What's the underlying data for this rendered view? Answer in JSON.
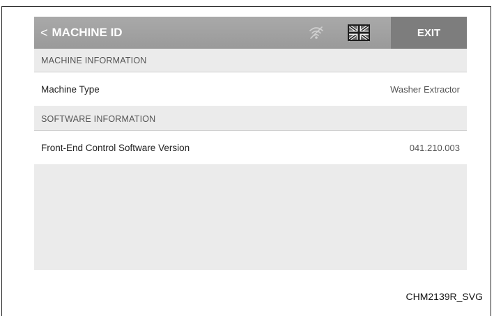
{
  "header": {
    "back_chevron": "<",
    "title": "MACHINE ID",
    "exit_label": "EXIT",
    "icons": [
      "wifi-off-icon",
      "language-flag-icon"
    ]
  },
  "sections": [
    {
      "title": "MACHINE INFORMATION",
      "rows": [
        {
          "label": "Machine Type",
          "value": "Washer Extractor"
        }
      ]
    },
    {
      "title": "SOFTWARE INFORMATION",
      "rows": [
        {
          "label": "Front-End Control Software Version",
          "value": "041.210.003"
        }
      ]
    }
  ],
  "caption": "CHM2139R_SVG",
  "colors": {
    "header_bg": "#9f9f9f",
    "exit_bg": "#7d7d7d",
    "screen_bg": "#ebebeb",
    "row_bg": "#ffffff"
  }
}
